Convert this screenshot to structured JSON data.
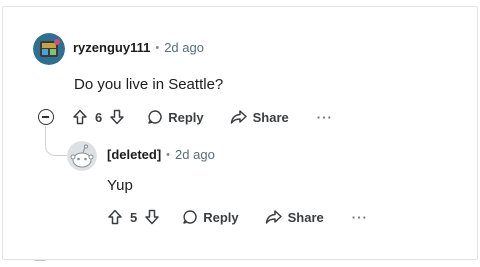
{
  "comment": {
    "username": "ryzenguy111",
    "time": "2d ago",
    "text": "Do you live in Seattle?",
    "votes": "6",
    "reply_label": "Reply",
    "share_label": "Share",
    "more_label": "···"
  },
  "reply": {
    "username": "[deleted]",
    "time": "2d ago",
    "text": "Yup",
    "votes": "5",
    "reply_label": "Reply",
    "share_label": "Share",
    "more_label": "···"
  },
  "separator": "•",
  "colors": {
    "text": "#1c1c1c",
    "meta": "#576f76",
    "action": "#3c3f42",
    "thread_line": "#d0d3d6"
  }
}
